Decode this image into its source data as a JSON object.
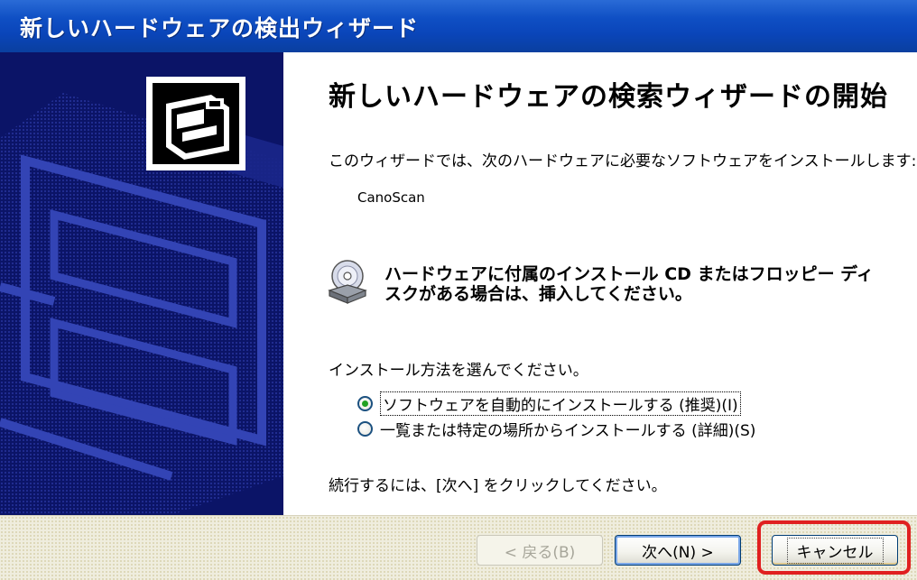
{
  "window": {
    "title": "新しいハードウェアの検出ウィザード"
  },
  "content": {
    "heading": "新しいハードウェアの検索ウィザードの開始",
    "intro": "このウィザードでは、次のハードウェアに必要なソフトウェアをインストールします:",
    "device_name": "CanoScan",
    "cd_notice": "ハードウェアに付属のインストール CD またはフロッピー ディスクがある場合は、挿入してください。",
    "choose_prompt": "インストール方法を選んでください。",
    "options": [
      {
        "label": "ソフトウェアを自動的にインストールする (推奨)(I)",
        "selected": true
      },
      {
        "label": "一覧または特定の場所からインストールする (詳細)(S)",
        "selected": false
      }
    ],
    "continue_text": "続行するには、[次へ] をクリックしてください。"
  },
  "buttons": {
    "back": "< 戻る(B)",
    "next": "次へ(N) >",
    "cancel": "キャンセル"
  },
  "colors": {
    "titlebar": "#0a45b9",
    "sidebar": "#0b1467",
    "highlight": "#e02020",
    "radio_dot": "#21a121"
  },
  "icons": {
    "wizard": "hardware-icon",
    "disc": "cd-drive-icon"
  }
}
